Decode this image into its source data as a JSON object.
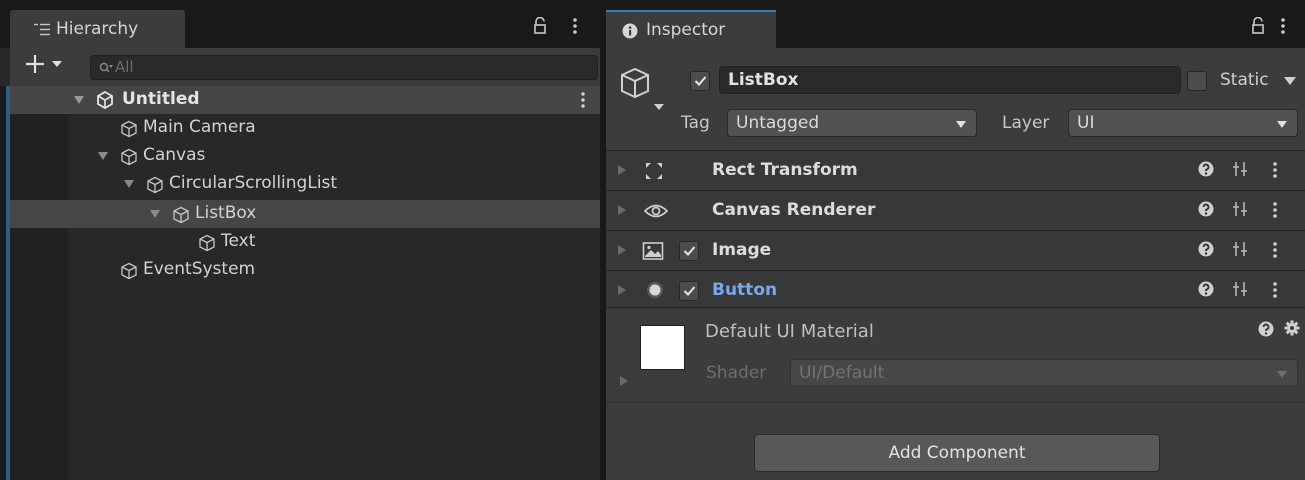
{
  "hierarchy": {
    "tab_label": "Hierarchy",
    "search_placeholder": "All",
    "scene_name": "Untitled",
    "items": [
      {
        "label": "Main Camera"
      },
      {
        "label": "Canvas"
      },
      {
        "label": "CircularScrollingList"
      },
      {
        "label": "ListBox"
      },
      {
        "label": "Text"
      },
      {
        "label": "EventSystem"
      }
    ]
  },
  "inspector": {
    "tab_label": "Inspector",
    "object_name": "ListBox",
    "static_label": "Static",
    "tag_label": "Tag",
    "tag_value": "Untagged",
    "layer_label": "Layer",
    "layer_value": "UI",
    "components": [
      {
        "title": "Rect Transform"
      },
      {
        "title": "Canvas Renderer"
      },
      {
        "title": "Image"
      },
      {
        "title": "Button"
      }
    ],
    "material": {
      "name": "Default UI Material",
      "shader_label": "Shader",
      "shader_value": "UI/Default"
    },
    "add_component_label": "Add Component"
  },
  "colors": {
    "accent_blue": "#7aa8f0",
    "tab_highlight": "#3a79bb",
    "selection_row": "#464646"
  }
}
